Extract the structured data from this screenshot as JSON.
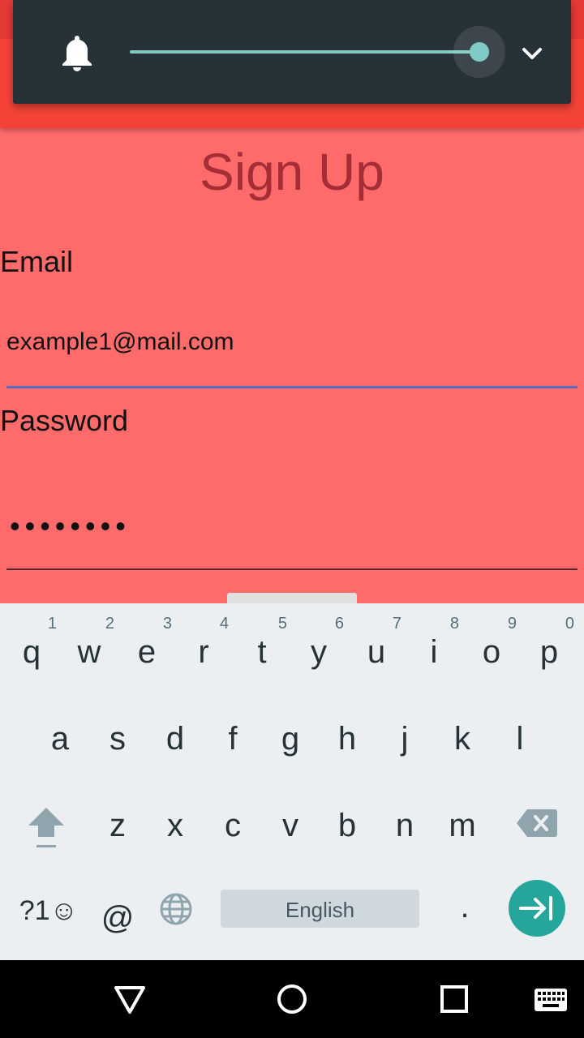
{
  "volume": {
    "level": 1.0,
    "track_color": "#80cbc4",
    "panel_color": "#263238",
    "icon": "bell-icon",
    "expand_icon": "chevron-down-icon"
  },
  "form": {
    "title": "Sign Up",
    "email_label": "Email",
    "email_value": "example1@mail.com",
    "password_label": "Password",
    "password_value": "••••••••"
  },
  "colors": {
    "app_bar": "#f44336",
    "background": "#ff6b6b",
    "title": "#a52d35",
    "accent": "#5c6bc0",
    "enter_key": "#26a69a"
  },
  "keyboard": {
    "row1": [
      {
        "key": "q",
        "hint": "1"
      },
      {
        "key": "w",
        "hint": "2"
      },
      {
        "key": "e",
        "hint": "3"
      },
      {
        "key": "r",
        "hint": "4"
      },
      {
        "key": "t",
        "hint": "5"
      },
      {
        "key": "y",
        "hint": "6"
      },
      {
        "key": "u",
        "hint": "7"
      },
      {
        "key": "i",
        "hint": "8"
      },
      {
        "key": "o",
        "hint": "9"
      },
      {
        "key": "p",
        "hint": "0"
      }
    ],
    "row2": [
      "a",
      "s",
      "d",
      "f",
      "g",
      "h",
      "j",
      "k",
      "l"
    ],
    "row3": [
      "z",
      "x",
      "c",
      "v",
      "b",
      "n",
      "m"
    ],
    "symbols_label": "?1☺",
    "at_label": "@",
    "space_label": "English",
    "period_label": "."
  },
  "nav": {
    "back_icon": "back-triangle-icon",
    "home_icon": "home-circle-icon",
    "recents_icon": "recents-square-icon",
    "keyboard_icon": "keyboard-icon"
  }
}
